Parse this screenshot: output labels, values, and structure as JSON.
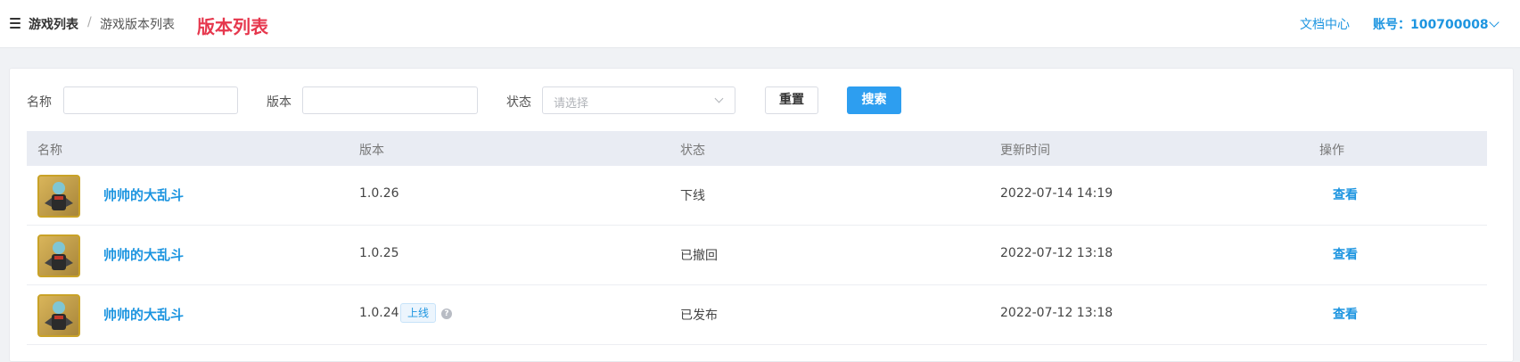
{
  "header": {
    "breadcrumb_root": "游戏列表",
    "breadcrumb_separator": "/",
    "breadcrumb_current": "游戏版本列表",
    "page_title": "版本列表",
    "doc_center": "文档中心",
    "account": "账号：100700008"
  },
  "filters": {
    "name_label": "名称",
    "name_value": "",
    "version_label": "版本",
    "version_value": "",
    "status_label": "状态",
    "status_placeholder": "请选择",
    "reset_label": "重置",
    "search_label": "搜索"
  },
  "table": {
    "columns": [
      "名称",
      "版本",
      "状态",
      "更新时间",
      "操作"
    ],
    "rows": [
      {
        "name": "帅帅的大乱斗",
        "version": "1.0.26",
        "badge": "",
        "status": "下线",
        "updated": "2022-07-14 14:19",
        "action": "查看"
      },
      {
        "name": "帅帅的大乱斗",
        "version": "1.0.25",
        "badge": "",
        "status": "已撤回",
        "updated": "2022-07-12 13:18",
        "action": "查看"
      },
      {
        "name": "帅帅的大乱斗",
        "version": "1.0.24",
        "badge": "上线",
        "status": "已发布",
        "updated": "2022-07-12 13:18",
        "action": "查看"
      }
    ]
  },
  "colors": {
    "accent": "#1d95e0",
    "title_red": "#e6374d",
    "primary_button": "#2d9ef0"
  }
}
